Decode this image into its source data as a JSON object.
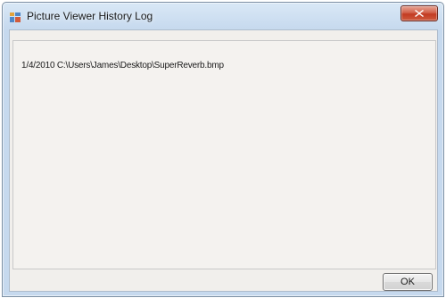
{
  "window": {
    "title": "Picture Viewer History Log"
  },
  "log": {
    "lines": [
      "1/4/2010 C:\\Users\\James\\Desktop\\SuperReverb.bmp"
    ]
  },
  "buttons": {
    "ok_label": "OK"
  },
  "icons": {
    "app": "application-icon",
    "close": "close-icon"
  },
  "colors": {
    "close_button": "#c23b22",
    "client_background": "#f1efec",
    "frame": "#c6d9ee"
  }
}
